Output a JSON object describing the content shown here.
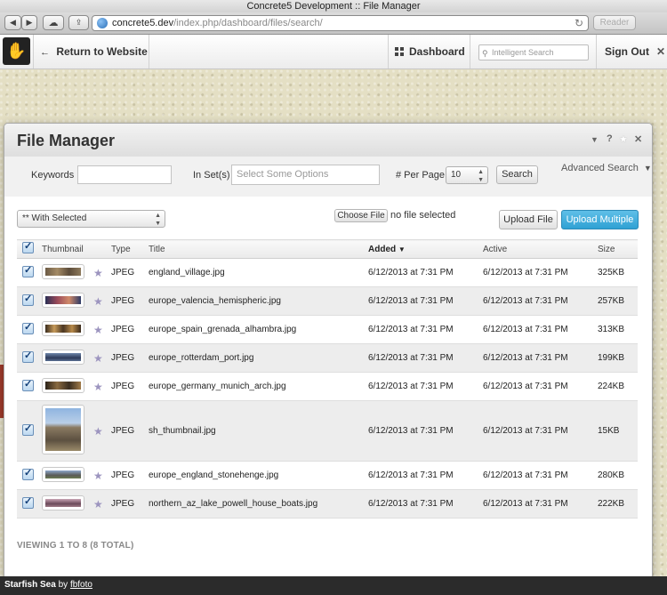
{
  "browser": {
    "window_title": "Concrete5 Development :: File Manager",
    "url_host": "concrete5.dev",
    "url_path": "/index.php/dashboard/files/search/",
    "reader_label": "Reader"
  },
  "toolbar": {
    "return_label": "Return to Website",
    "dashboard_label": "Dashboard",
    "search_placeholder": "Intelligent Search",
    "signout_label": "Sign Out"
  },
  "dialog": {
    "title": "File Manager"
  },
  "filters": {
    "keywords_label": "Keywords",
    "sets_label": "In Set(s)",
    "sets_placeholder": "Select Some Options",
    "per_page_label": "# Per Page",
    "per_page_value": "10",
    "search_button": "Search",
    "advanced_search": "Advanced Search"
  },
  "actions": {
    "with_selected": "** With Selected",
    "choose_file": "Choose File",
    "no_file": "no file selected",
    "upload_file": "Upload File",
    "upload_multiple": "Upload Multiple"
  },
  "table": {
    "headers": {
      "thumbnail": "Thumbnail",
      "type": "Type",
      "title": "Title",
      "added": "Added",
      "active": "Active",
      "size": "Size"
    },
    "rows": [
      {
        "type": "JPEG",
        "title": "england_village.jpg",
        "added": "6/12/2013 at 7:31 PM",
        "active": "6/12/2013 at 7:31 PM",
        "size": "325KB"
      },
      {
        "type": "JPEG",
        "title": "europe_valencia_hemispheric.jpg",
        "added": "6/12/2013 at 7:31 PM",
        "active": "6/12/2013 at 7:31 PM",
        "size": "257KB"
      },
      {
        "type": "JPEG",
        "title": "europe_spain_grenada_alhambra.jpg",
        "added": "6/12/2013 at 7:31 PM",
        "active": "6/12/2013 at 7:31 PM",
        "size": "313KB"
      },
      {
        "type": "JPEG",
        "title": "europe_rotterdam_port.jpg",
        "added": "6/12/2013 at 7:31 PM",
        "active": "6/12/2013 at 7:31 PM",
        "size": "199KB"
      },
      {
        "type": "JPEG",
        "title": "europe_germany_munich_arch.jpg",
        "added": "6/12/2013 at 7:31 PM",
        "active": "6/12/2013 at 7:31 PM",
        "size": "224KB"
      },
      {
        "type": "JPEG",
        "title": "sh_thumbnail.jpg",
        "added": "6/12/2013 at 7:31 PM",
        "active": "6/12/2013 at 7:31 PM",
        "size": "15KB"
      },
      {
        "type": "JPEG",
        "title": "europe_england_stonehenge.jpg",
        "added": "6/12/2013 at 7:31 PM",
        "active": "6/12/2013 at 7:31 PM",
        "size": "280KB"
      },
      {
        "type": "JPEG",
        "title": "northern_az_lake_powell_house_boats.jpg",
        "added": "6/12/2013 at 7:31 PM",
        "active": "6/12/2013 at 7:31 PM",
        "size": "222KB"
      }
    ]
  },
  "footer": {
    "count": "VIEWING 1 TO 8 (8 TOTAL)"
  },
  "credit": {
    "title": "Starfish Sea",
    "by": "by",
    "author": "fbfoto"
  },
  "colors": {
    "primary_button": "#2fa1d4",
    "checkbox_check": "#123f78",
    "credit_bar": "#2b2b2b"
  }
}
